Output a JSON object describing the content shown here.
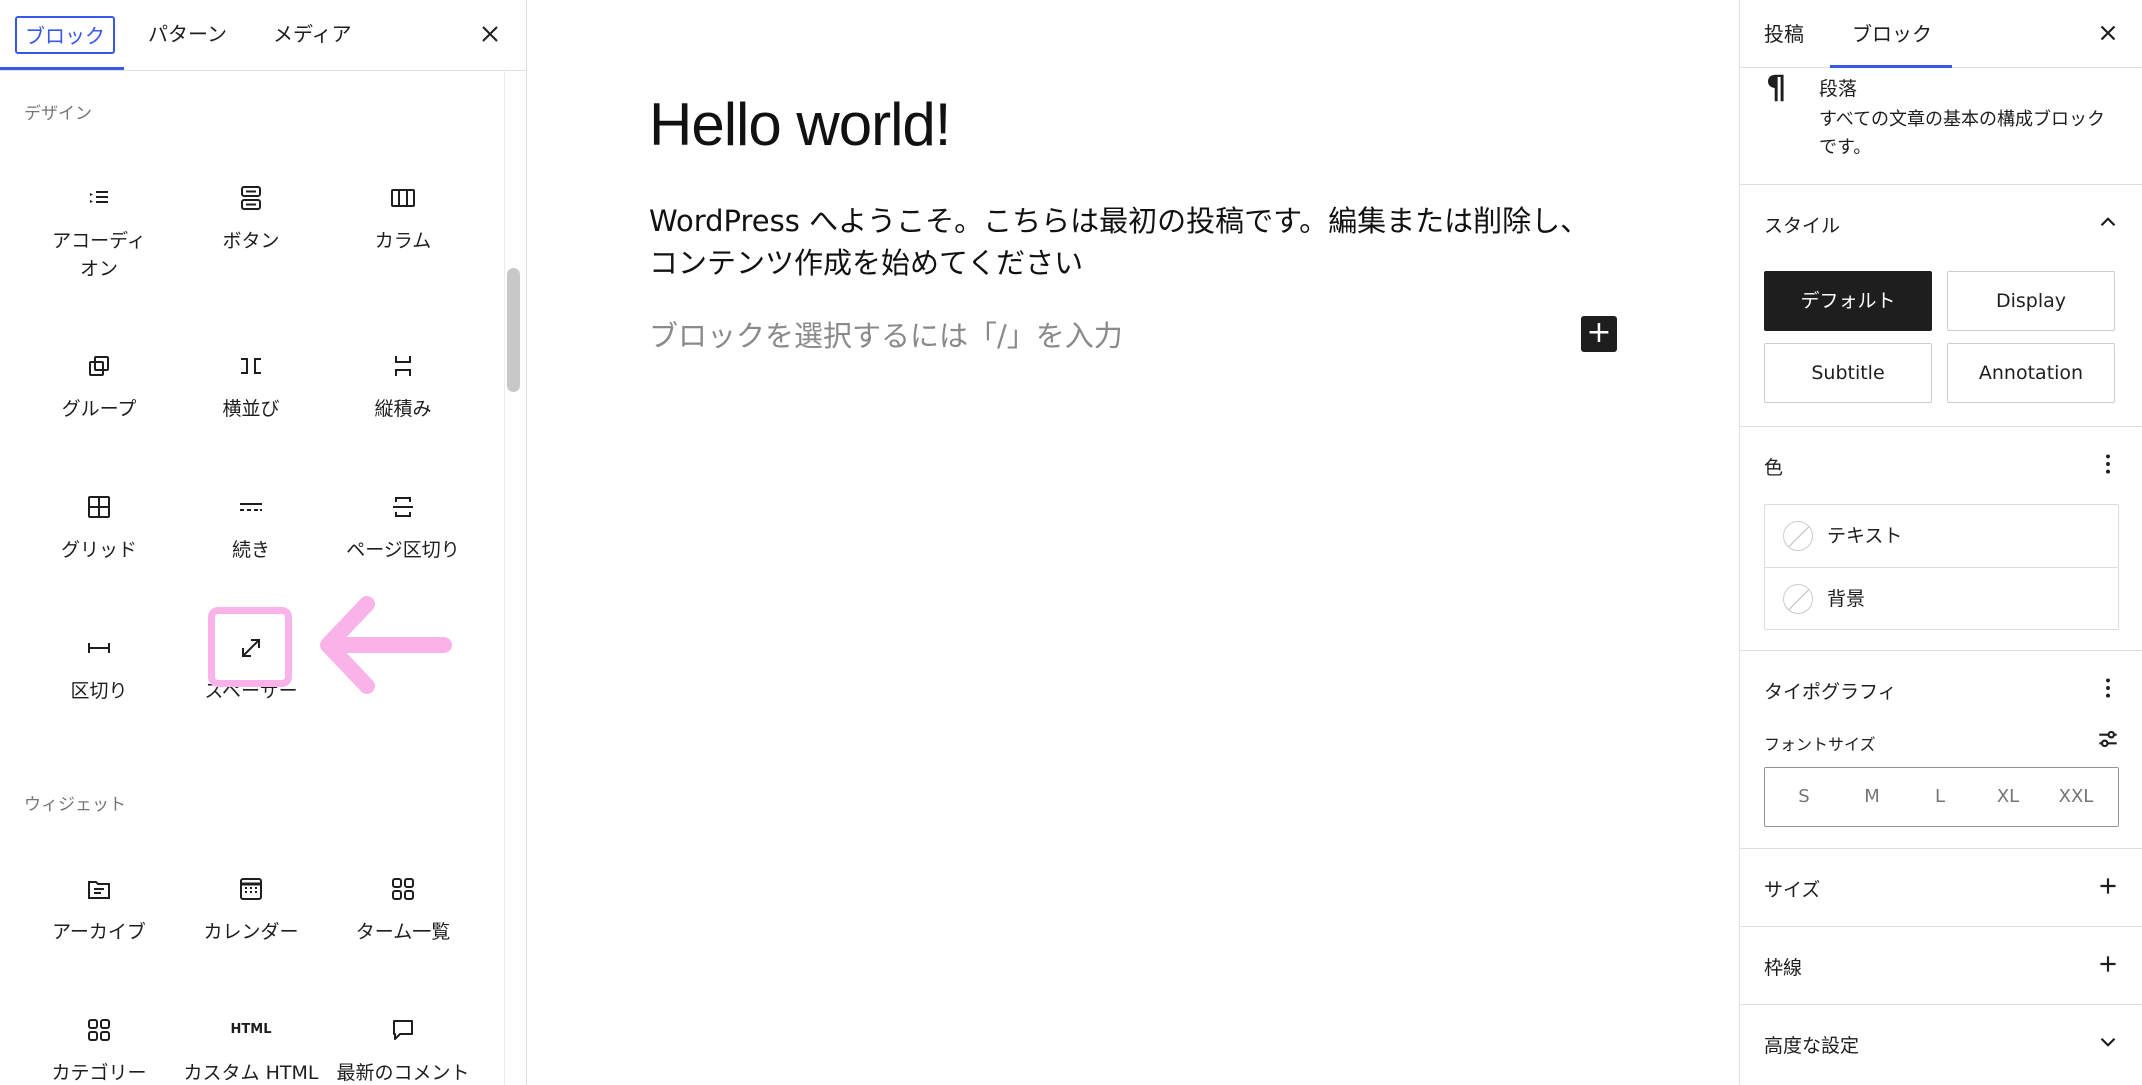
{
  "inserter": {
    "tabs": [
      "ブロック",
      "パターン",
      "メディア"
    ],
    "categories": {
      "design": "デザイン",
      "widgets": "ウィジェット"
    },
    "design_blocks": [
      {
        "label": "アコーディオン"
      },
      {
        "label": "ボタン"
      },
      {
        "label": "カラム"
      },
      {
        "label": "グループ"
      },
      {
        "label": "横並び"
      },
      {
        "label": "縦積み"
      },
      {
        "label": "グリッド"
      },
      {
        "label": "続き"
      },
      {
        "label": "ページ区切り"
      },
      {
        "label": "区切り"
      },
      {
        "label": "スペーサー"
      }
    ],
    "widget_blocks": [
      {
        "label": "アーカイブ"
      },
      {
        "label": "カレンダー"
      },
      {
        "label": "ターム一覧"
      },
      {
        "label": "カテゴリー"
      },
      {
        "label": "カスタム HTML"
      },
      {
        "label": "最新のコメント"
      }
    ],
    "html_icon_text": "HTML"
  },
  "editor": {
    "title": "Hello world!",
    "body_line1": "WordPress へようこそ。こちらは最初の投稿です。編集または削除し、",
    "body_line2": "コンテンツ作成を始めてください",
    "placeholder": "ブロックを選択するには「/」を入力",
    "add_block_symbol": "+"
  },
  "sidebar": {
    "tabs": [
      "投稿",
      "ブロック"
    ],
    "block_card": {
      "icon": "¶",
      "name": "段落",
      "description": "すべての文章の基本の構成ブロックです。"
    },
    "style": {
      "title": "スタイル",
      "options": [
        "デフォルト",
        "Display",
        "Subtitle",
        "Annotation"
      ],
      "selected": "デフォルト"
    },
    "color": {
      "title": "色",
      "items": [
        "テキスト",
        "背景"
      ]
    },
    "typography": {
      "title": "タイポグラフィ",
      "font_size_label": "フォントサイズ",
      "sizes": [
        "S",
        "M",
        "L",
        "XL",
        "XXL"
      ]
    },
    "size": {
      "title": "サイズ"
    },
    "border": {
      "title": "枠線"
    },
    "advanced": {
      "title": "高度な設定"
    }
  },
  "colors": {
    "accent": "#3858e9",
    "dark": "#1e1e1e",
    "highlight": "#f9b3e8"
  }
}
